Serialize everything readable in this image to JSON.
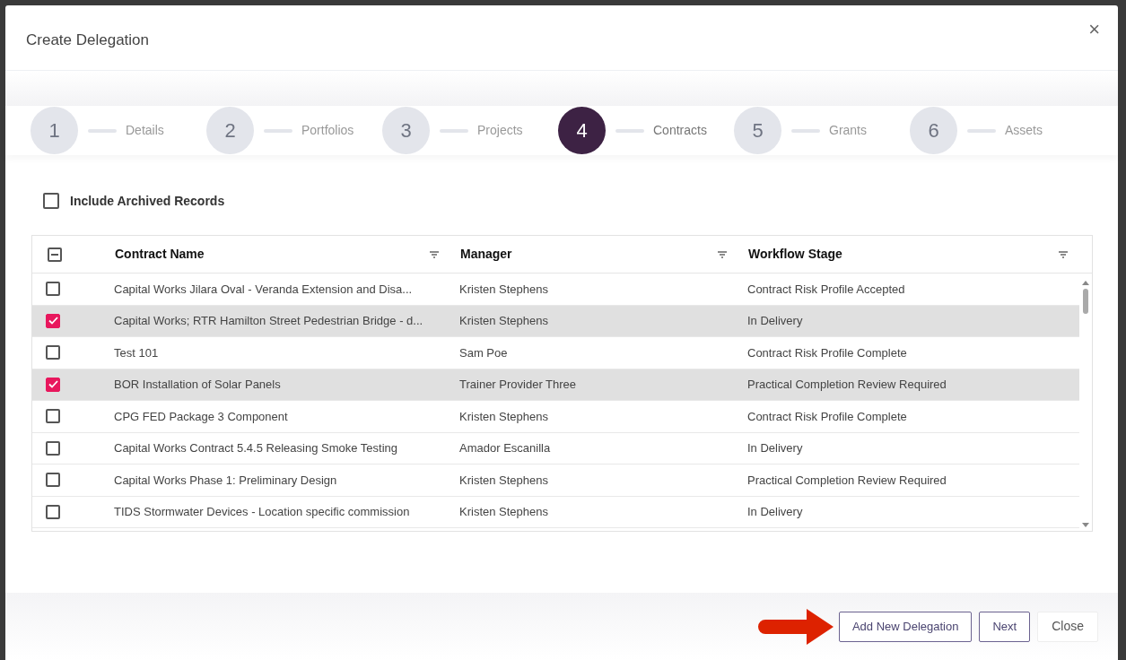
{
  "dialog": {
    "title": "Create Delegation",
    "close_icon": "×"
  },
  "steps": [
    {
      "number": "1",
      "label": "Details",
      "selected": false
    },
    {
      "number": "2",
      "label": "Portfolios",
      "selected": false
    },
    {
      "number": "3",
      "label": "Projects",
      "selected": false
    },
    {
      "number": "4",
      "label": "Contracts",
      "selected": true
    },
    {
      "number": "5",
      "label": "Grants",
      "selected": false
    },
    {
      "number": "6",
      "label": "Assets",
      "selected": false
    }
  ],
  "include_archived": {
    "label": "Include Archived Records",
    "checked": false
  },
  "table": {
    "select_all": {
      "indeterminate": true
    },
    "columns": [
      "Contract Name",
      "Manager",
      "Workflow Stage"
    ],
    "rows": [
      {
        "cells": [
          "Capital Works Jilara Oval - Veranda Extension and Disa...",
          "Kristen Stephens",
          "Contract Risk Profile Accepted"
        ],
        "selected": false
      },
      {
        "cells": [
          "Capital Works; RTR Hamilton Street Pedestrian Bridge - d...",
          "Kristen Stephens",
          "In Delivery"
        ],
        "selected": true
      },
      {
        "cells": [
          "Test 101",
          "Sam Poe",
          "Contract Risk Profile Complete"
        ],
        "selected": false
      },
      {
        "cells": [
          "BOR Installation of Solar Panels",
          "Trainer Provider Three",
          "Practical Completion Review Required"
        ],
        "selected": true
      },
      {
        "cells": [
          "CPG FED Package 3 Component",
          "Kristen Stephens",
          "Contract Risk Profile Complete"
        ],
        "selected": false
      },
      {
        "cells": [
          "Capital Works Contract 5.4.5 Releasing Smoke Testing",
          "Amador Escanilla",
          "In Delivery"
        ],
        "selected": false
      },
      {
        "cells": [
          "Capital Works Phase 1: Preliminary Design",
          "Kristen Stephens",
          "Practical Completion Review Required"
        ],
        "selected": false
      },
      {
        "cells": [
          "TIDS Stormwater Devices - Location specific commission",
          "Kristen Stephens",
          "In Delivery"
        ],
        "selected": false
      }
    ]
  },
  "buttons": [
    {
      "label": "Add New Delegation",
      "kind": "outlined"
    },
    {
      "label": "Next",
      "kind": "outlined"
    },
    {
      "label": "Close",
      "kind": "plain"
    }
  ]
}
